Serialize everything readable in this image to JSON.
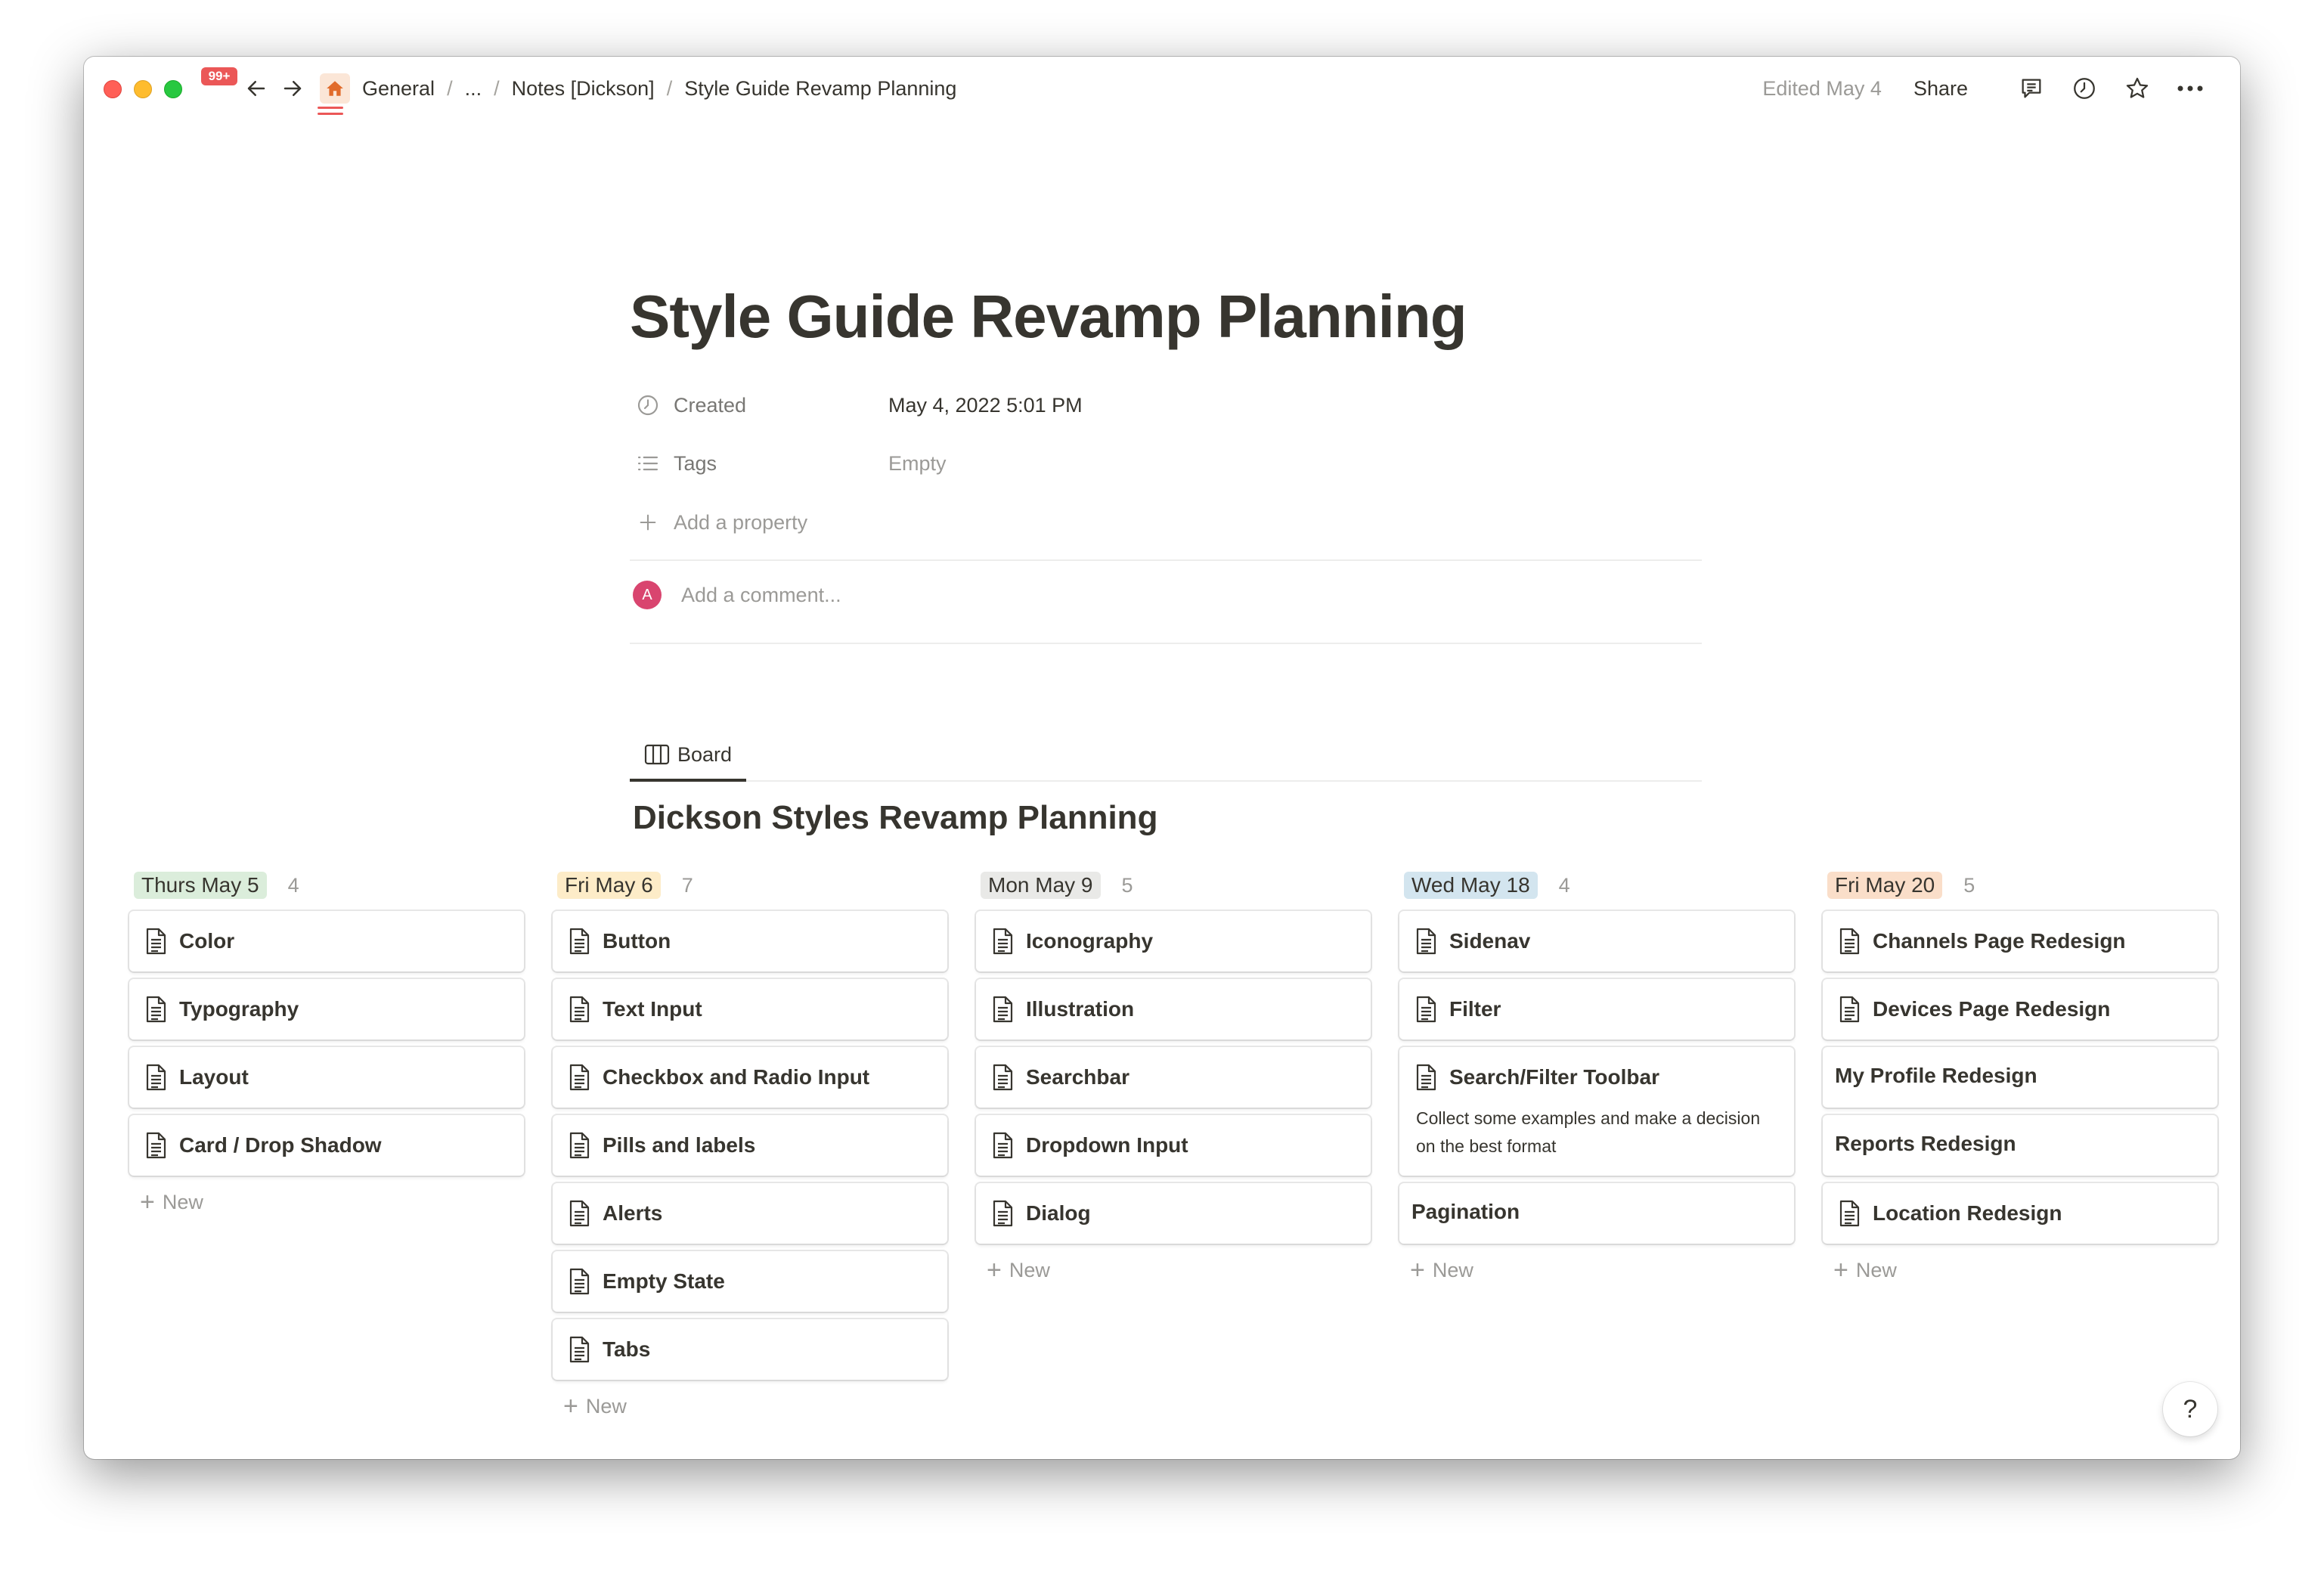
{
  "window": {
    "notification_badge": "99+",
    "breadcrumb": [
      "General",
      "...",
      "Notes [Dickson]",
      "Style Guide Revamp Planning"
    ],
    "edited": "Edited May 4",
    "share": "Share"
  },
  "page": {
    "title": "Style Guide Revamp Planning",
    "properties": [
      {
        "label": "Created",
        "value": "May 4, 2022 5:01 PM",
        "icon": "clock-icon"
      },
      {
        "label": "Tags",
        "value": "Empty",
        "icon": "list-icon"
      }
    ],
    "add_property": "Add a property",
    "comment": {
      "avatar_letter": "A",
      "placeholder": "Add a comment..."
    },
    "view_tab": "Board",
    "board_title": "Dickson Styles Revamp Planning"
  },
  "board": {
    "new_label": "New",
    "columns": [
      {
        "name": "Thurs May 5",
        "count": "4",
        "color": "#dbeddb",
        "cards": [
          "Color",
          "Typography",
          "Layout",
          "Card / Drop Shadow"
        ]
      },
      {
        "name": "Fri May 6",
        "count": "7",
        "color": "#fdecc8",
        "cards": [
          "Button",
          "Text Input",
          "Checkbox and Radio Input",
          "Pills and labels",
          "Alerts",
          "Empty State",
          "Tabs"
        ]
      },
      {
        "name": "Mon May 9",
        "count": "5",
        "color": "#e9e9e7",
        "cards": [
          "Iconography",
          "Illustration",
          "Searchbar",
          "Dropdown Input",
          "Dialog"
        ]
      },
      {
        "name": "Wed May 18",
        "count": "4",
        "color": "#d3e5ef",
        "cards": [
          "Sidenav",
          "Filter",
          "Search/Filter Toolbar",
          "Pagination"
        ],
        "card_description": "Collect some examples and make a decision on the best format"
      },
      {
        "name": "Fri May 20",
        "count": "5",
        "color": "#fadec9",
        "cards": [
          "Channels Page Redesign",
          "Devices Page Redesign",
          "My Profile Redesign",
          "Reports Redesign",
          "Location Redesign"
        ]
      }
    ]
  },
  "help": "?"
}
